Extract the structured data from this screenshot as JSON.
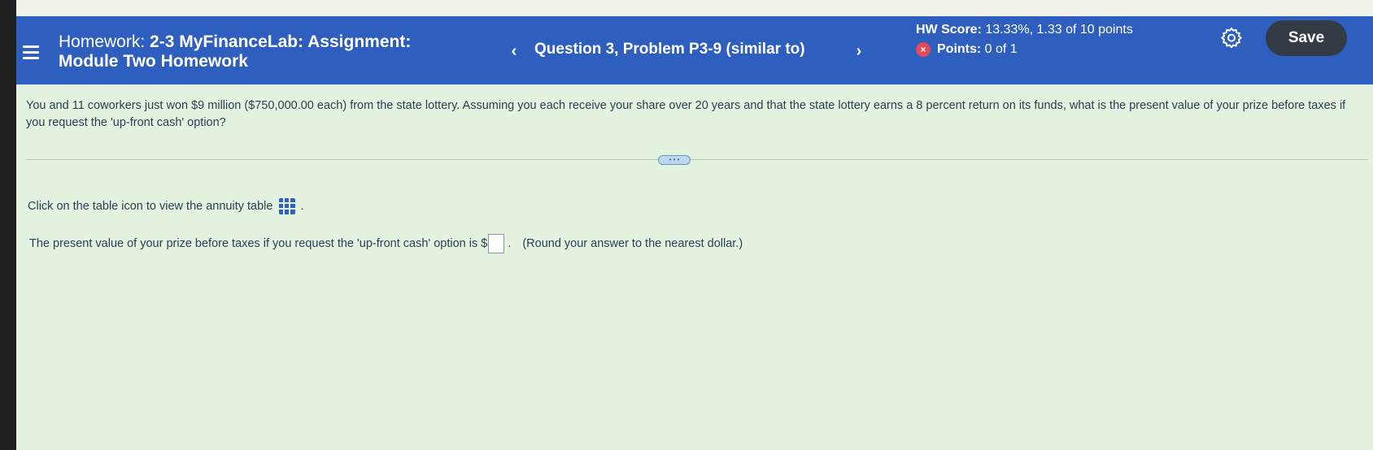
{
  "header": {
    "title_prefix": "Homework:",
    "title_bold": "2-3 MyFinanceLab: Assignment:",
    "subtitle": "Module Two Homework",
    "nav_prev": "‹",
    "question_label": "Question 3, Problem P3-9 (similar to)",
    "nav_next": "›",
    "hw_score_label": "HW Score:",
    "hw_score_value": "13.33%, 1.33 of 10 points",
    "points_label": "Points:",
    "points_value": "0 of 1",
    "points_badge": "×",
    "save_label": "Save"
  },
  "question": {
    "text": "You and 11 coworkers just won $9 million ($750,000.00 each) from the state lottery. Assuming you each receive your share over 20 years and that the state lottery earns a 8 percent return on its funds, what is the present value of your prize before taxes if you request the 'up-front cash' option?",
    "expand_label": "• • •",
    "click_instruction": "Click on the table icon to view the annuity table",
    "click_suffix": ".",
    "answer_prefix": "The present value of your prize before taxes if you request the 'up-front cash' option is $",
    "answer_value": "",
    "answer_suffix": ".",
    "round_note": "(Round your answer to the nearest dollar.)"
  },
  "icons": {
    "menu": "hamburger-icon",
    "settings": "gear-icon",
    "table": "table-icon",
    "incorrect": "x-circle-icon"
  },
  "colors": {
    "header_bg": "#2e5fbf",
    "page_bg": "#e3f3e0",
    "save_bg": "#333b44",
    "badge_red": "#e04a5a",
    "text": "#2c3d55"
  }
}
